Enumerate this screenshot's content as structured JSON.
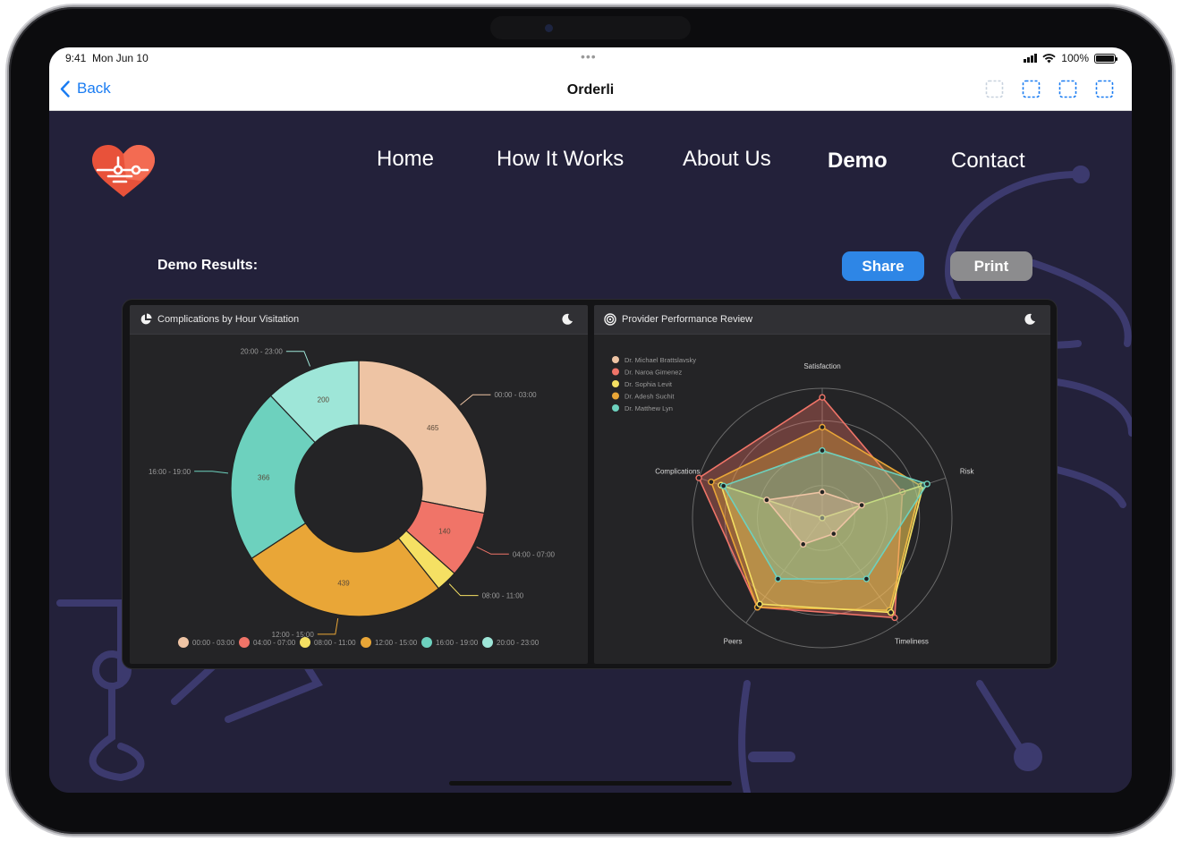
{
  "status_bar": {
    "time": "9:41",
    "date": "Mon Jun 10",
    "battery": "100%"
  },
  "browser": {
    "back_label": "Back",
    "title": "Orderli"
  },
  "site": {
    "nav": [
      {
        "label": "Home",
        "active": false
      },
      {
        "label": "How It Works",
        "active": false
      },
      {
        "label": "About Us",
        "active": false
      },
      {
        "label": "Demo",
        "active": true
      },
      {
        "label": "Contact",
        "active": false
      }
    ],
    "demo_results_label": "Demo Results:",
    "share_label": "Share",
    "print_label": "Print"
  },
  "colors": {
    "background": "#23213a",
    "deco_lines": "#3c3a6e",
    "share": "#2e86e6",
    "print": "#8c8c8e",
    "logo_red": "#e8523a"
  },
  "icons": [
    "back-chevron-icon",
    "tabs-icon",
    "heart-logo-icon",
    "pie-icon",
    "radar-icon",
    "moon-icon"
  ],
  "chart_data": [
    {
      "type": "donut",
      "title": "Complications by Hour Visitation",
      "categories": [
        "00:00 - 03:00",
        "04:00 - 07:00",
        "08:00 - 11:00",
        "12:00 - 15:00",
        "16:00 - 19:00",
        "20:00 - 23:00"
      ],
      "values": [
        465,
        140,
        45,
        439,
        366,
        200
      ],
      "colors": [
        "#eec4a4",
        "#f07468",
        "#f5e063",
        "#e9a637",
        "#6dd1be",
        "#9ee6d8"
      ],
      "legend": "bottom"
    },
    {
      "type": "radar",
      "title": "Provider Performance Review",
      "axes": [
        "Satisfaction",
        "Risk",
        "Timeliness",
        "Peers",
        "Complications"
      ],
      "max": 100,
      "series": [
        {
          "name": "Dr. Michael Brattslavsky",
          "color": "#eec4a4",
          "values": [
            20,
            32,
            15,
            25,
            45
          ]
        },
        {
          "name": "Dr. Naroa Gimenez",
          "color": "#f07468",
          "values": [
            93,
            65,
            95,
            85,
            100
          ]
        },
        {
          "name": "Dr. Sophia Levit",
          "color": "#f5e063",
          "values": [
            0,
            82,
            90,
            82,
            82
          ]
        },
        {
          "name": "Dr. Adesh Suchit",
          "color": "#e9a637",
          "values": [
            70,
            80,
            88,
            85,
            90
          ]
        },
        {
          "name": "Dr. Matthew Lyn",
          "color": "#6dd1be",
          "values": [
            52,
            85,
            58,
            58,
            80
          ]
        }
      ],
      "legend": "top-left"
    }
  ]
}
